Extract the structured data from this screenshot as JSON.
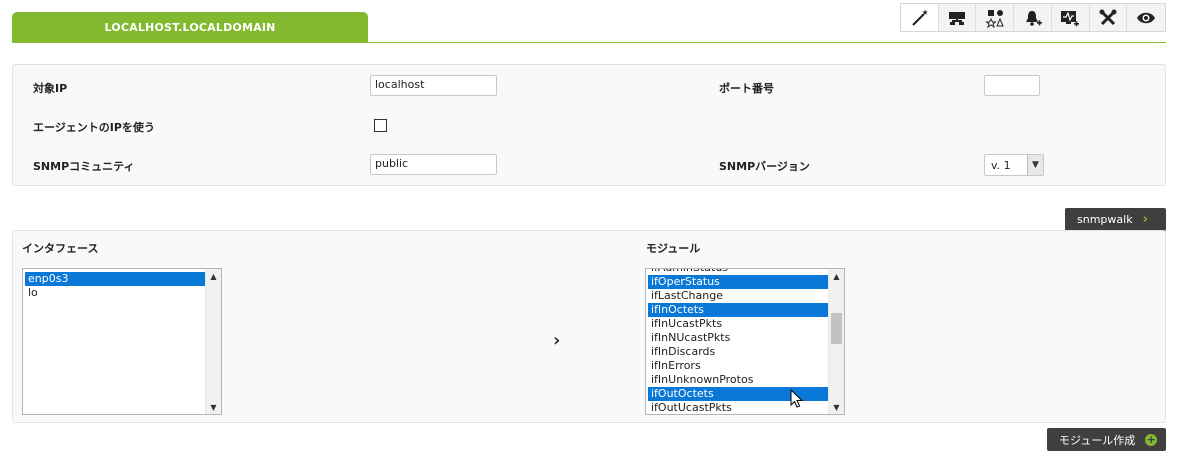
{
  "header": {
    "active_tab": "LOCALHOST.LOCALDOMAIN",
    "toolbar_icons": [
      "wand-icon",
      "network-icon",
      "shapes-icon",
      "bell-plus-icon",
      "monitor-plus-icon",
      "tools-icon",
      "eye-icon"
    ]
  },
  "form": {
    "target_ip_label": "対象IP",
    "target_ip_value": "localhost",
    "port_label": "ポート番号",
    "port_value": "",
    "use_agent_ip_label": "エージェントのIPを使う",
    "use_agent_ip_checked": false,
    "snmp_community_label": "SNMPコミュニティ",
    "snmp_community_value": "public",
    "snmp_version_label": "SNMPバージョン",
    "snmp_version_value": "v. 1"
  },
  "buttons": {
    "snmpwalk": "snmpwalk",
    "create_modules": "モジュール作成"
  },
  "interfaces": {
    "label": "インタフェース",
    "items": [
      {
        "text": "enp0s3",
        "selected": true
      },
      {
        "text": "lo",
        "selected": false
      }
    ]
  },
  "modules": {
    "label": "モジュール",
    "partial_top": "ifAdminStatus",
    "items": [
      {
        "text": "ifOperStatus",
        "selected": true
      },
      {
        "text": "ifLastChange",
        "selected": false
      },
      {
        "text": "ifInOctets",
        "selected": true
      },
      {
        "text": "ifInUcastPkts",
        "selected": false
      },
      {
        "text": "ifInNUcastPkts",
        "selected": false
      },
      {
        "text": "ifInDiscards",
        "selected": false
      },
      {
        "text": "ifInErrors",
        "selected": false
      },
      {
        "text": "ifInUnknownProtos",
        "selected": false
      },
      {
        "text": "ifOutOctets",
        "selected": true
      },
      {
        "text": "ifOutUcastPkts",
        "selected": false
      }
    ]
  },
  "colors": {
    "accent": "#82b92e",
    "selection": "#0a78d7",
    "button_dark": "#3f3f3f"
  }
}
